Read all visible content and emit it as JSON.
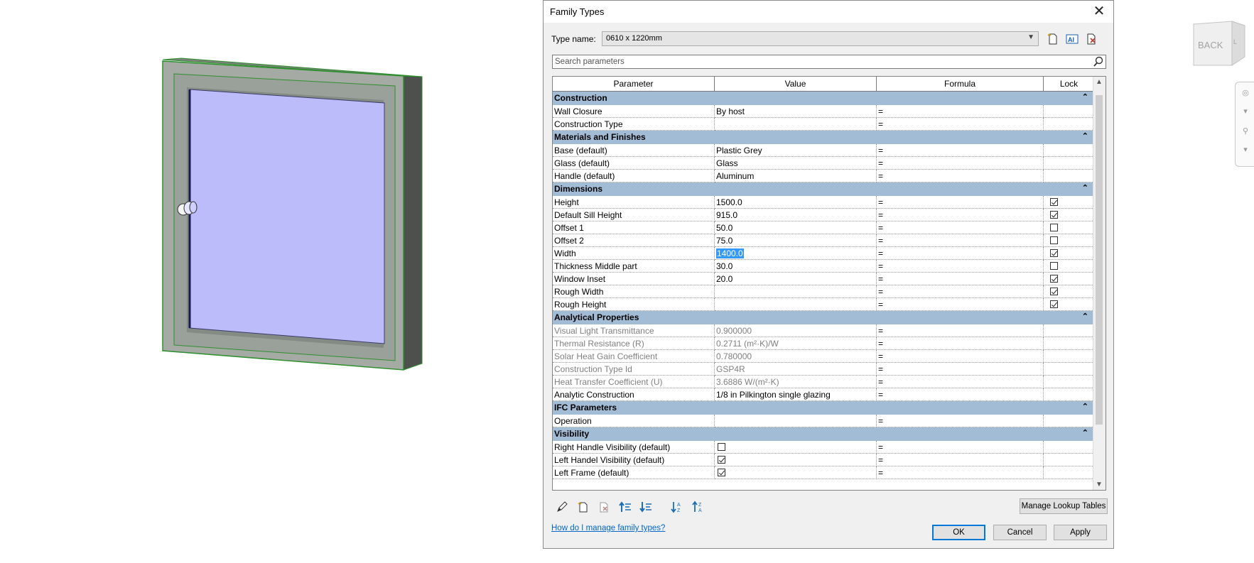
{
  "dialog": {
    "title": "Family Types",
    "type_name_label": "Type name:",
    "type_name_value": "0610 x 1220mm",
    "search_placeholder": "Search parameters",
    "columns": [
      "Parameter",
      "Value",
      "Formula",
      "Lock"
    ],
    "groups": [
      {
        "name": "Construction",
        "rows": [
          {
            "param": "Wall Closure",
            "value": "By host",
            "formula": "=",
            "lock": null
          },
          {
            "param": "Construction Type",
            "value": "",
            "formula": "=",
            "lock": null
          }
        ]
      },
      {
        "name": "Materials and Finishes",
        "rows": [
          {
            "param": "Base (default)",
            "value": "Plastic Grey",
            "formula": "=",
            "lock": null
          },
          {
            "param": "Glass (default)",
            "value": "Glass",
            "formula": "=",
            "lock": null
          },
          {
            "param": "Handle (default)",
            "value": "Aluminum",
            "formula": "=",
            "lock": null
          }
        ]
      },
      {
        "name": "Dimensions",
        "rows": [
          {
            "param": "Height",
            "value": "1500.0",
            "formula": "=",
            "lock": true
          },
          {
            "param": "Default Sill Height",
            "value": "915.0",
            "formula": "=",
            "lock": true
          },
          {
            "param": "Offset 1",
            "value": "50.0",
            "formula": "=",
            "lock": false
          },
          {
            "param": "Offset 2",
            "value": "75.0",
            "formula": "=",
            "lock": false
          },
          {
            "param": "Width",
            "value": "1400.0",
            "formula": "=",
            "lock": true,
            "selected": true
          },
          {
            "param": "Thickness Middle part",
            "value": "30.0",
            "formula": "=",
            "lock": false
          },
          {
            "param": "Window Inset",
            "value": "20.0",
            "formula": "=",
            "lock": true
          },
          {
            "param": "Rough Width",
            "value": "",
            "formula": "=",
            "lock": true
          },
          {
            "param": "Rough Height",
            "value": "",
            "formula": "=",
            "lock": true
          }
        ]
      },
      {
        "name": "Analytical Properties",
        "rows": [
          {
            "param": "Visual Light Transmittance",
            "value": "0.900000",
            "formula": "=",
            "lock": null,
            "dim": true
          },
          {
            "param": "Thermal Resistance (R)",
            "value": "0.2711 (m²·K)/W",
            "formula": "=",
            "lock": null,
            "dim": true
          },
          {
            "param": "Solar Heat Gain Coefficient",
            "value": "0.780000",
            "formula": "=",
            "lock": null,
            "dim": true
          },
          {
            "param": "Construction Type Id",
            "value": "GSP4R",
            "formula": "=",
            "lock": null,
            "dim": true
          },
          {
            "param": "Heat Transfer Coefficient (U)",
            "value": "3.6886 W/(m²·K)",
            "formula": "=",
            "lock": null,
            "dim": true
          },
          {
            "param": "Analytic Construction",
            "value": "1/8 in Pilkington single glazing",
            "formula": "=",
            "lock": null
          }
        ]
      },
      {
        "name": "IFC Parameters",
        "rows": [
          {
            "param": "Operation",
            "value": "",
            "formula": "=",
            "lock": null
          }
        ]
      },
      {
        "name": "Visibility",
        "rows": [
          {
            "param": "Right Handle Visibility (default)",
            "value_checkbox": false,
            "formula": "=",
            "lock": null
          },
          {
            "param": "Left Handel Visibility (default)",
            "value_checkbox": true,
            "formula": "=",
            "lock": null
          },
          {
            "param": "Left Frame (default)",
            "value_checkbox": true,
            "formula": "=",
            "lock": null
          }
        ]
      }
    ],
    "manage_lookup_label": "Manage Lookup Tables",
    "help_link": "How do I manage family types?",
    "ok_label": "OK",
    "cancel_label": "Cancel",
    "apply_label": "Apply",
    "collapse_glyph": "⌃"
  },
  "viewcube": {
    "face_label": "BACK",
    "side_label": "LEFT"
  },
  "colors": {
    "group_header": "#a3bcd6",
    "glass": "#bcbcfb",
    "frame": "#a5aaa5",
    "edge_green": "#2f8f2f",
    "selection": "#3399ff"
  }
}
